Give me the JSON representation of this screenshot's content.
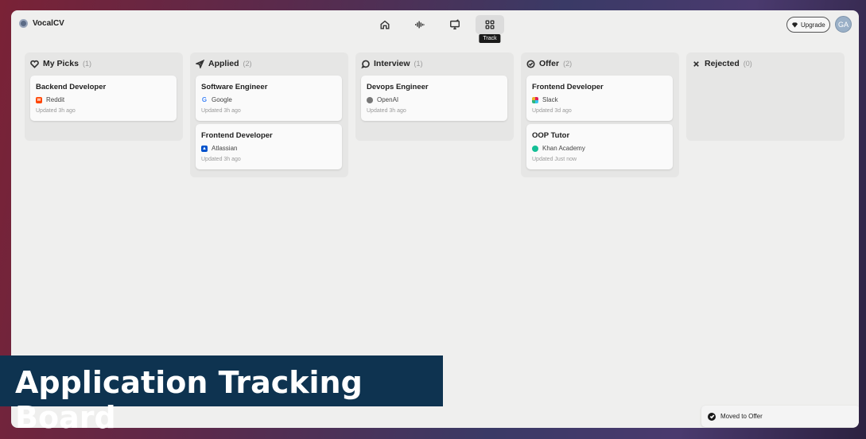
{
  "app": {
    "name": "VocalCV"
  },
  "nav": {
    "items": [
      {
        "id": "home",
        "icon": "home-icon"
      },
      {
        "id": "voice",
        "icon": "waveform-icon"
      },
      {
        "id": "screen",
        "icon": "monitor-icon"
      },
      {
        "id": "track",
        "icon": "grid-icon",
        "tooltip": "Track",
        "active": true
      }
    ]
  },
  "header": {
    "upgrade_label": "Upgrade",
    "avatar_initials": "GA"
  },
  "columns": [
    {
      "title": "My Picks",
      "count": "(1)",
      "icon": "heart-icon",
      "cards": [
        {
          "title": "Backend Developer",
          "company": "Reddit",
          "updated": "Updated 3h ago",
          "logo_color": "#ff4500"
        }
      ]
    },
    {
      "title": "Applied",
      "count": "(2)",
      "icon": "send-icon",
      "cards": [
        {
          "title": "Software Engineer",
          "company": "Google",
          "updated": "Updated 3h ago",
          "logo_color": "#4285f4"
        },
        {
          "title": "Frontend Developer",
          "company": "Atlassian",
          "updated": "Updated 3h ago",
          "logo_color": "#0052cc"
        }
      ]
    },
    {
      "title": "Interview",
      "count": "(1)",
      "icon": "chat-bubble-icon",
      "cards": [
        {
          "title": "Devops Engineer",
          "company": "OpenAI",
          "updated": "Updated 3h ago",
          "logo_color": "#555555"
        }
      ]
    },
    {
      "title": "Offer",
      "count": "(2)",
      "icon": "check-circle-icon",
      "cards": [
        {
          "title": "Frontend Developer",
          "company": "Slack",
          "updated": "Updated 3d ago",
          "logo_color": "#e01e5a"
        },
        {
          "title": "OOP Tutor",
          "company": "Khan Academy",
          "updated": "Updated Just now",
          "logo_color": "#14bf96"
        }
      ]
    },
    {
      "title": "Rejected",
      "count": "(0)",
      "icon": "close-icon",
      "cards": []
    }
  ],
  "banner": {
    "text": "Application Tracking Board"
  },
  "toast": {
    "text": "Moved to Offer"
  }
}
